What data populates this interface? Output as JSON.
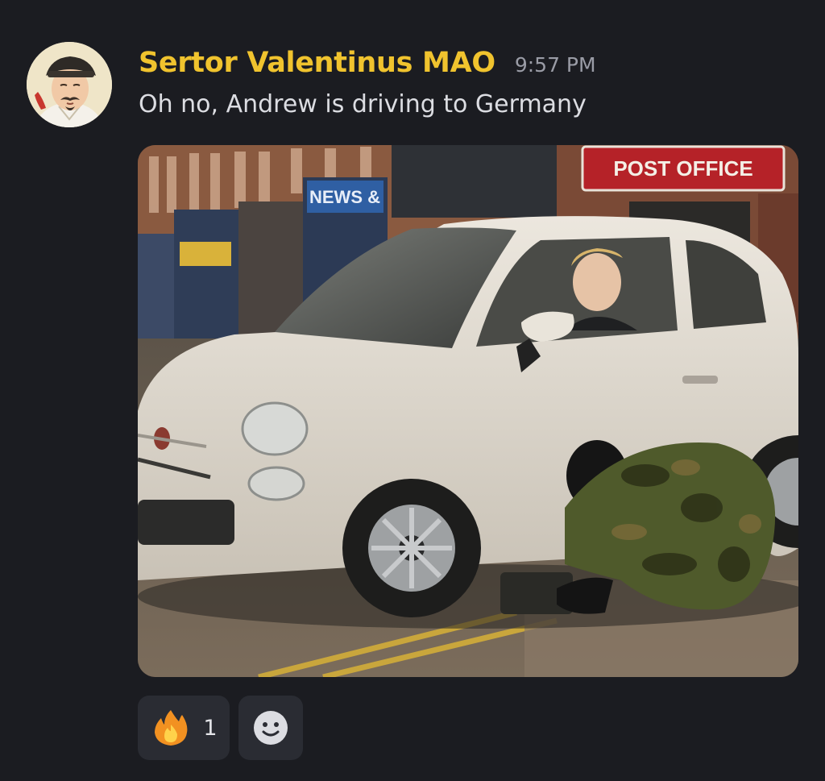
{
  "message": {
    "author": "Sertor Valentinus MAO",
    "timestamp": "9:57 PM",
    "text": "Oh no, Andrew is driving to Germany",
    "author_color": "#f0c32e"
  },
  "attachment": {
    "kind": "image",
    "signs": {
      "post_office": "POST OFFICE",
      "news_shop": "NEWS &"
    }
  },
  "reactions": [
    {
      "emoji": "fire-icon",
      "count": "1"
    },
    {
      "emoji": "add-reaction-icon"
    }
  ],
  "colors": {
    "background": "#1b1c21",
    "reaction_bg": "#2a2c33",
    "timestamp": "#9a9ca6",
    "text": "#dcdde2"
  }
}
